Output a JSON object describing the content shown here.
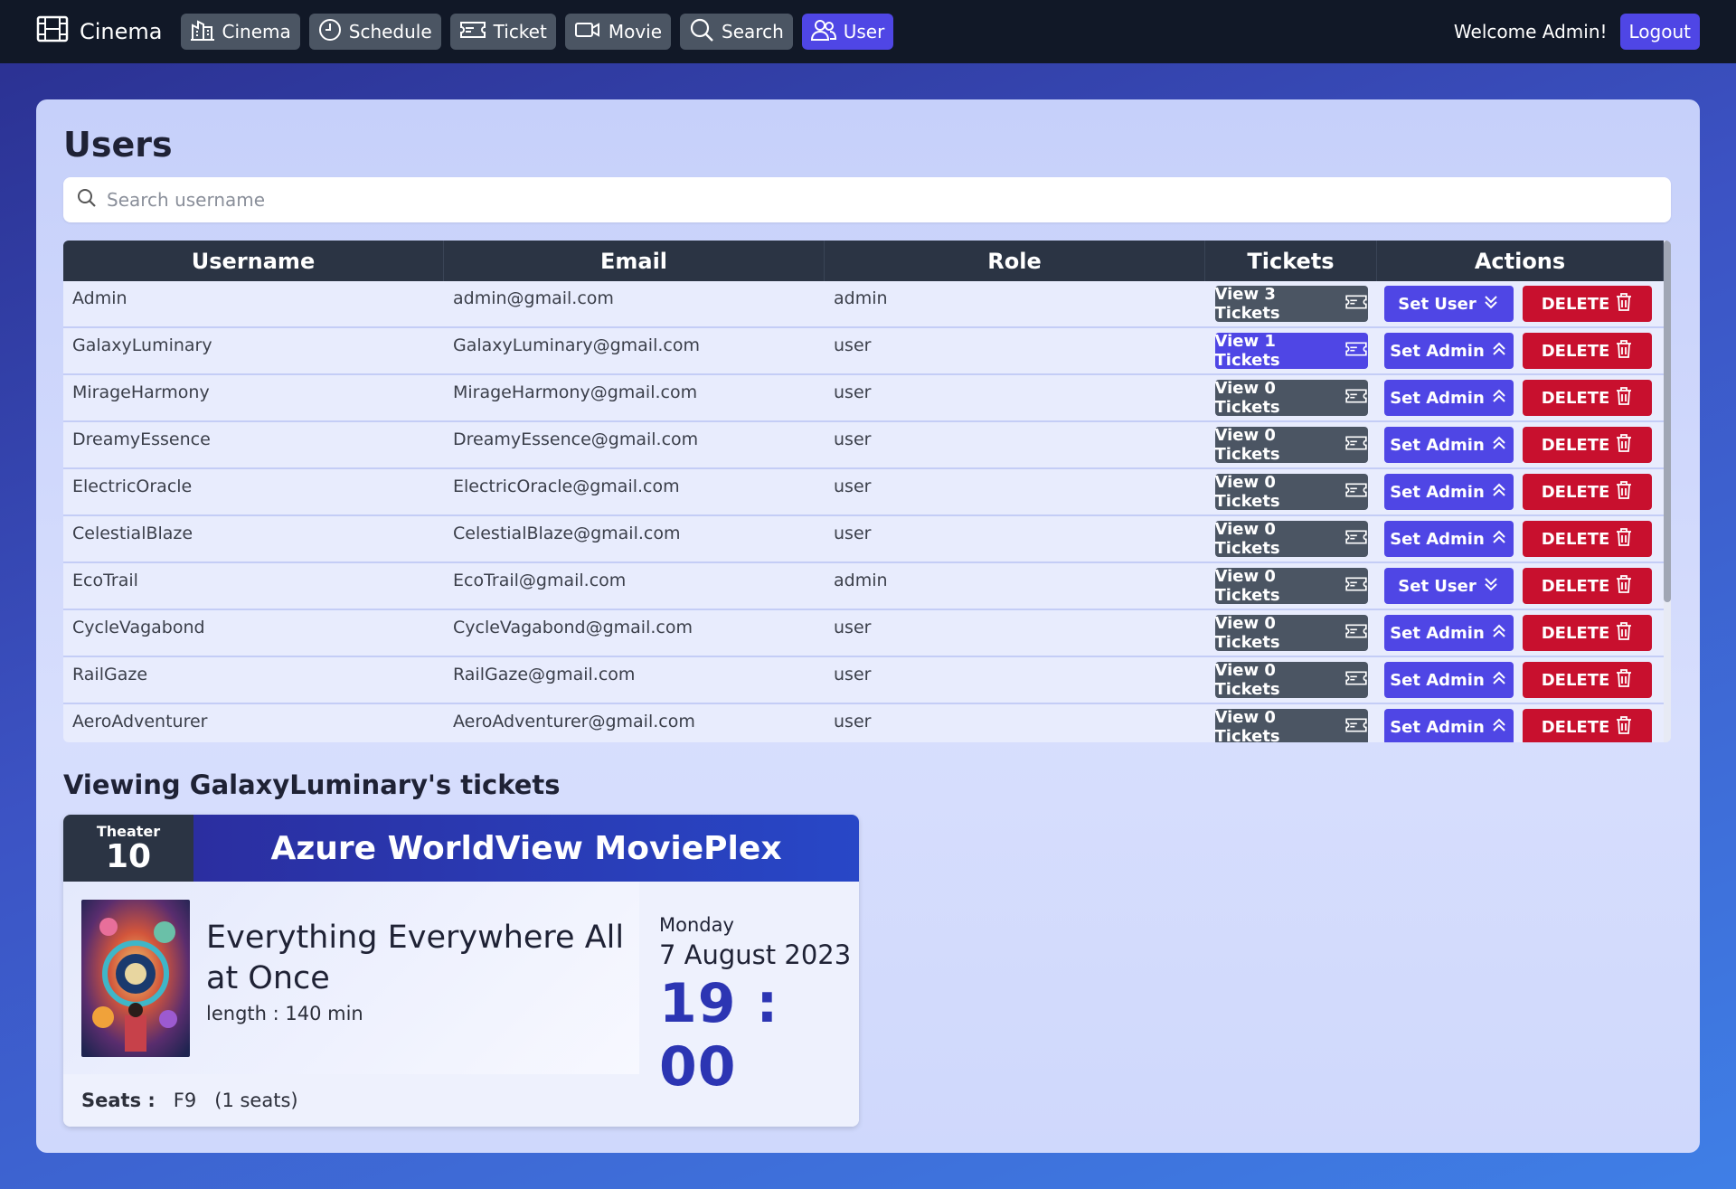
{
  "nav": {
    "brand": "Cinema",
    "items": [
      {
        "label": "Cinema",
        "icon": "building-icon"
      },
      {
        "label": "Schedule",
        "icon": "clock-icon"
      },
      {
        "label": "Ticket",
        "icon": "ticket-icon"
      },
      {
        "label": "Movie",
        "icon": "video-camera-icon"
      },
      {
        "label": "Search",
        "icon": "search-icon"
      },
      {
        "label": "User",
        "icon": "users-icon",
        "active": true
      }
    ],
    "welcome": "Welcome Admin!",
    "logout": "Logout"
  },
  "users": {
    "title": "Users",
    "search_placeholder": "Search username",
    "columns": [
      "Username",
      "Email",
      "Role",
      "Tickets",
      "Actions"
    ],
    "rows": [
      {
        "username": "Admin",
        "email": "admin@gmail.com",
        "role": "admin",
        "tickets_label": "View 3 Tickets",
        "role_action": "Set User",
        "delete_label": "DELETE"
      },
      {
        "username": "GalaxyLuminary",
        "email": "GalaxyLuminary@gmail.com",
        "role": "user",
        "tickets_label": "View 1 Tickets",
        "role_action": "Set Admin",
        "delete_label": "DELETE",
        "selected": true
      },
      {
        "username": "MirageHarmony",
        "email": "MirageHarmony@gmail.com",
        "role": "user",
        "tickets_label": "View 0 Tickets",
        "role_action": "Set Admin",
        "delete_label": "DELETE"
      },
      {
        "username": "DreamyEssence",
        "email": "DreamyEssence@gmail.com",
        "role": "user",
        "tickets_label": "View 0 Tickets",
        "role_action": "Set Admin",
        "delete_label": "DELETE"
      },
      {
        "username": "ElectricOracle",
        "email": "ElectricOracle@gmail.com",
        "role": "user",
        "tickets_label": "View 0 Tickets",
        "role_action": "Set Admin",
        "delete_label": "DELETE"
      },
      {
        "username": "CelestialBlaze",
        "email": "CelestialBlaze@gmail.com",
        "role": "user",
        "tickets_label": "View 0 Tickets",
        "role_action": "Set Admin",
        "delete_label": "DELETE"
      },
      {
        "username": "EcoTrail",
        "email": "EcoTrail@gmail.com",
        "role": "admin",
        "tickets_label": "View 0 Tickets",
        "role_action": "Set User",
        "delete_label": "DELETE"
      },
      {
        "username": "CycleVagabond",
        "email": "CycleVagabond@gmail.com",
        "role": "user",
        "tickets_label": "View 0 Tickets",
        "role_action": "Set Admin",
        "delete_label": "DELETE"
      },
      {
        "username": "RailGaze",
        "email": "RailGaze@gmail.com",
        "role": "user",
        "tickets_label": "View 0 Tickets",
        "role_action": "Set Admin",
        "delete_label": "DELETE"
      },
      {
        "username": "AeroAdventurer",
        "email": "AeroAdventurer@gmail.com",
        "role": "user",
        "tickets_label": "View 0 Tickets",
        "role_action": "Set Admin",
        "delete_label": "DELETE"
      }
    ]
  },
  "viewing": {
    "title": "Viewing GalaxyLuminary's tickets",
    "ticket": {
      "theater_label": "Theater",
      "theater_number": "10",
      "venue": "Azure WorldView MoviePlex",
      "movie_title": "Everything Everywhere All at Once",
      "length": "length : 140 min",
      "day": "Monday",
      "date": "7 August 2023",
      "time": "19 : 00",
      "seats_label": "Seats :",
      "seats": "F9",
      "seat_count": "(1 seats)"
    }
  },
  "colors": {
    "navbar": "#111827",
    "nav_button": "#4b5563",
    "accent": "#4f46e5",
    "danger": "#c8102e",
    "table_header": "#2b3444",
    "time_color": "#2c35b3"
  }
}
